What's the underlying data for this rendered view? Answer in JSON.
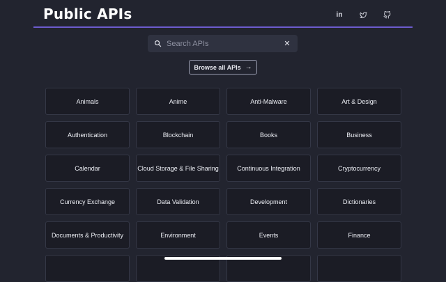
{
  "header": {
    "title": "Public APIs",
    "social": [
      {
        "label": "in",
        "icon": "linkedin-icon"
      },
      {
        "label": "",
        "icon": "twitter-icon"
      },
      {
        "label": "",
        "icon": "github-icon"
      }
    ],
    "accent_color": "#6d5ccf"
  },
  "search": {
    "placeholder": "Search APIs",
    "value": "",
    "clear_label": "✕"
  },
  "browse_button": {
    "label": "Browse all APIs",
    "arrow": "→"
  },
  "categories": [
    "Animals",
    "Anime",
    "Anti-Malware",
    "Art & Design",
    "Authentication",
    "Blockchain",
    "Books",
    "Business",
    "Calendar",
    "Cloud Storage & File Sharing",
    "Continuous Integration",
    "Cryptocurrency",
    "Currency Exchange",
    "Data Validation",
    "Development",
    "Dictionaries",
    "Documents & Productivity",
    "Environment",
    "Events",
    "Finance",
    "",
    "",
    "",
    ""
  ]
}
